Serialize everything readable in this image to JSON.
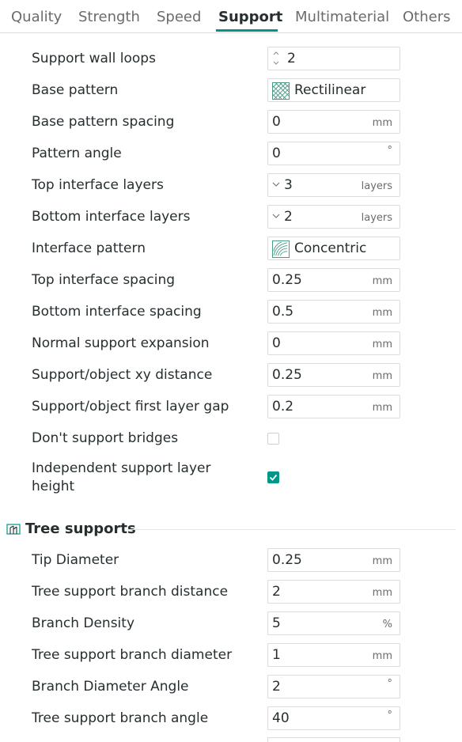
{
  "tabs": [
    {
      "label": "Quality"
    },
    {
      "label": "Strength"
    },
    {
      "label": "Speed"
    },
    {
      "label": "Support",
      "active": true
    },
    {
      "label": "Multimaterial"
    },
    {
      "label": "Others"
    }
  ],
  "accent_color": "#009688",
  "settings": [
    {
      "label": "Support wall loops",
      "value": "2"
    },
    {
      "label": "Base pattern",
      "value": "Rectilinear",
      "icon": "rectilinear-pattern-icon"
    },
    {
      "label": "Base pattern spacing",
      "value": "0",
      "unit": "mm"
    },
    {
      "label": "Pattern angle",
      "value": "0",
      "unit": "°"
    },
    {
      "label": "Top interface layers",
      "value": "3",
      "unit": "layers"
    },
    {
      "label": "Bottom interface layers",
      "value": "2",
      "unit": "layers"
    },
    {
      "label": "Interface pattern",
      "value": "Concentric",
      "icon": "concentric-pattern-icon"
    },
    {
      "label": "Top interface spacing",
      "value": "0.25",
      "unit": "mm"
    },
    {
      "label": "Bottom interface spacing",
      "value": "0.5",
      "unit": "mm"
    },
    {
      "label": "Normal support expansion",
      "value": "0",
      "unit": "mm"
    },
    {
      "label": "Support/object xy distance",
      "value": "0.25",
      "unit": "mm"
    },
    {
      "label": "Support/object first layer gap",
      "value": "0.2",
      "unit": "mm"
    },
    {
      "label": "Don't support bridges",
      "checked": false
    },
    {
      "label": "Independent support layer height",
      "checked": true
    }
  ],
  "tree_section": {
    "title": "Tree supports",
    "icon": "tree-support-icon"
  },
  "tree_settings": [
    {
      "label": "Tip Diameter",
      "value": "0.25",
      "unit": "mm"
    },
    {
      "label": "Tree support branch distance",
      "value": "2",
      "unit": "mm"
    },
    {
      "label": "Branch Density",
      "value": "5",
      "unit": "%"
    },
    {
      "label": "Tree support branch diameter",
      "value": "1",
      "unit": "mm"
    },
    {
      "label": "Branch Diameter Angle",
      "value": "2",
      "unit": "°"
    },
    {
      "label": "Tree support branch angle",
      "value": "40",
      "unit": "°"
    }
  ]
}
